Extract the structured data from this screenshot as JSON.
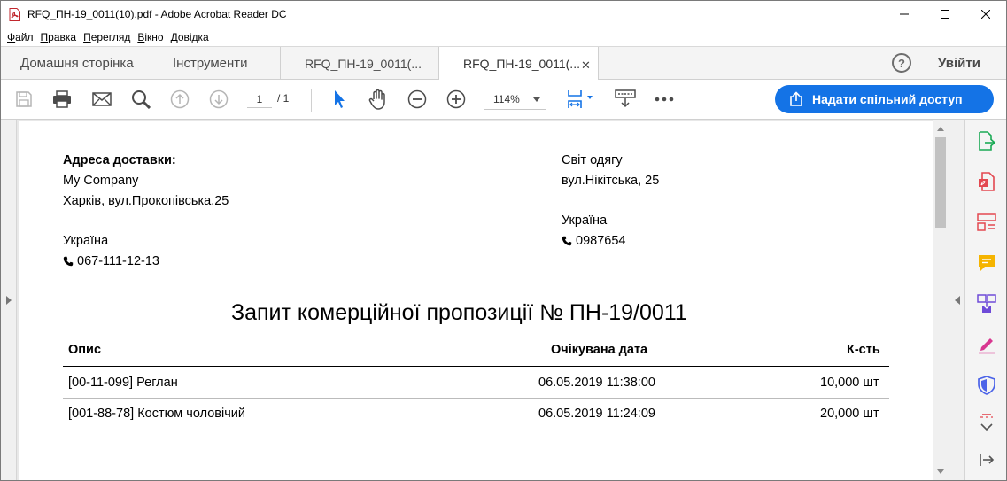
{
  "window": {
    "title": "RFQ_ПН-19_0011(10).pdf - Adobe Acrobat Reader DC"
  },
  "menu": [
    {
      "u": "Ф",
      "rest": "айл"
    },
    {
      "u": "П",
      "rest": "равка"
    },
    {
      "u": "П",
      "rest": "ерегляд"
    },
    {
      "u": "В",
      "rest": "ікно"
    },
    {
      "u": "Д",
      "rest": "овідка"
    }
  ],
  "tabs": {
    "home": "Домашня сторінка",
    "tools": "Інструменти",
    "doc1": "RFQ_ПН-19_0011(...",
    "doc2": "RFQ_ПН-19_0011(...",
    "close": "✕",
    "help": "?",
    "signin": "Увійти"
  },
  "toolbar": {
    "page_current": "1",
    "page_total": "/ 1",
    "zoom": "114%",
    "share_label": "Надати спільний доступ"
  },
  "document": {
    "delivery": {
      "heading": "Адреса доставки:",
      "company": "My Company",
      "street": "Харків, вул.Прокопівська,25",
      "country": "Україна",
      "phone": "067-111-12-13"
    },
    "vendor": {
      "name": "Світ одягу",
      "street": "вул.Нікітська, 25",
      "country": "Україна",
      "phone": "0987654"
    },
    "title": "Запит комерційної пропозиції № ПН-19/0011",
    "table": {
      "headers": [
        "Опис",
        "Очікувана дата",
        "К-сть"
      ],
      "rows": [
        [
          "[00-11-099] Реглан",
          "06.05.2019 11:38:00",
          "10,000 шт"
        ],
        [
          "[001-88-78] Костюм чоловічий",
          "06.05.2019 11:24:09",
          "20,000 шт"
        ]
      ]
    }
  },
  "colors": {
    "accent": "#1473e6",
    "pdf_red": "#d83b01"
  }
}
